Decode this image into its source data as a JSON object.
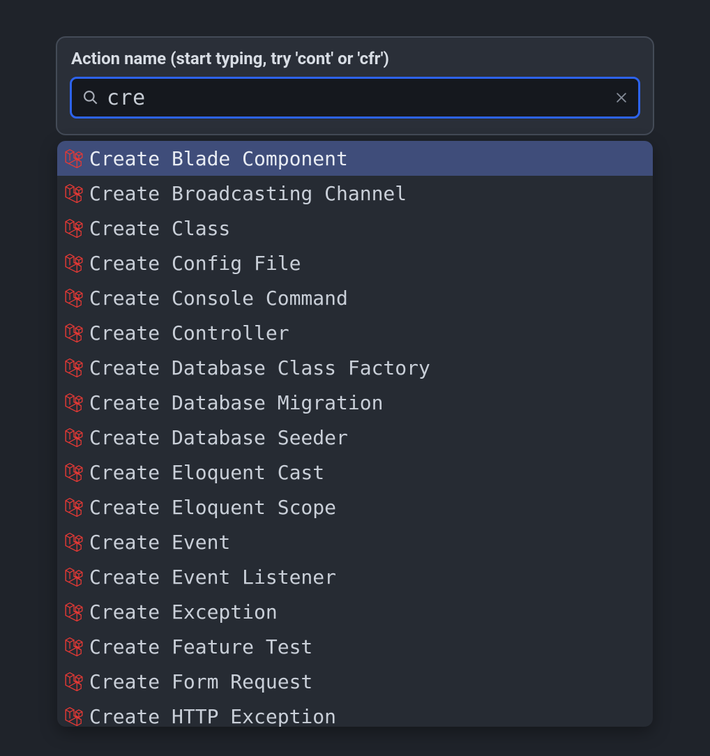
{
  "search": {
    "label": "Action name (start typing, try 'cont' or 'cfr')",
    "value": "cre",
    "placeholder": ""
  },
  "icons": {
    "search": "search-icon",
    "clear": "close-icon",
    "laravel": "laravel-icon"
  },
  "colors": {
    "accent": "#2d63ed",
    "laravel": "#e53935",
    "selected": "#3f4d7a"
  },
  "results": [
    {
      "label": "Create Blade Component",
      "selected": true
    },
    {
      "label": "Create Broadcasting Channel",
      "selected": false
    },
    {
      "label": "Create Class",
      "selected": false
    },
    {
      "label": "Create Config File",
      "selected": false
    },
    {
      "label": "Create Console Command",
      "selected": false
    },
    {
      "label": "Create Controller",
      "selected": false
    },
    {
      "label": "Create Database Class Factory",
      "selected": false
    },
    {
      "label": "Create Database Migration",
      "selected": false
    },
    {
      "label": "Create Database Seeder",
      "selected": false
    },
    {
      "label": "Create Eloquent Cast",
      "selected": false
    },
    {
      "label": "Create Eloquent Scope",
      "selected": false
    },
    {
      "label": "Create Event",
      "selected": false
    },
    {
      "label": "Create Event Listener",
      "selected": false
    },
    {
      "label": "Create Exception",
      "selected": false
    },
    {
      "label": "Create Feature Test",
      "selected": false
    },
    {
      "label": "Create Form Request",
      "selected": false
    },
    {
      "label": "Create HTTP Exception",
      "selected": false
    }
  ]
}
